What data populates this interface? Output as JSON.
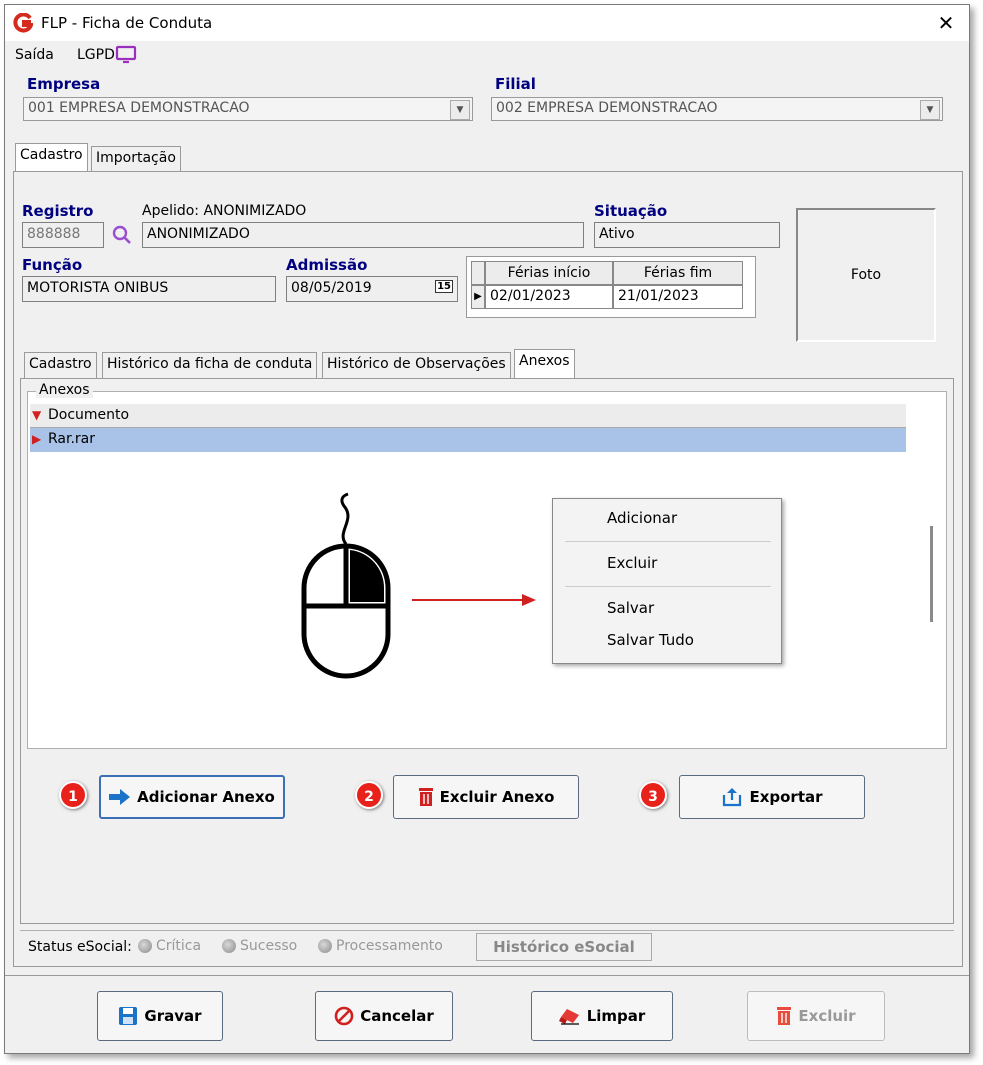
{
  "window": {
    "title": "FLP - Ficha de Conduta"
  },
  "menu": {
    "saida": "Saída",
    "lgpd": "LGPD"
  },
  "empresa": {
    "label": "Empresa",
    "value": "001 EMPRESA DEMONSTRACAO"
  },
  "filial": {
    "label": "Filial",
    "value": "002 EMPRESA DEMONSTRACAO"
  },
  "top_tabs": [
    "Cadastro",
    "Importação"
  ],
  "employee": {
    "registro_label": "Registro",
    "registro_value": "888888",
    "apelido_label": "Apelido: ANONIMIZADO",
    "nome_value": "ANONIMIZADO",
    "situacao_label": "Situação",
    "situacao_value": "Ativo",
    "funcao_label": "Função",
    "funcao_value": "MOTORISTA ONIBUS",
    "admissao_label": "Admissão",
    "admissao_value": "08/05/2019",
    "calendar_icon_text": "15",
    "foto_label": "Foto"
  },
  "ferias": {
    "columns": [
      "Férias início",
      "Férias fim"
    ],
    "rows": [
      [
        "02/01/2023",
        "21/01/2023"
      ]
    ]
  },
  "inner_tabs": [
    "Cadastro",
    "Histórico da ficha de conduta",
    "Histórico de Observações",
    "Anexos"
  ],
  "anexos": {
    "group_label": "Anexos",
    "column": "Documento",
    "rows": [
      "Rar.rar"
    ]
  },
  "context_menu": [
    "Adicionar",
    "Excluir",
    "Salvar",
    "Salvar Tudo"
  ],
  "actions": {
    "badges": [
      "1",
      "2",
      "3"
    ],
    "add": "Adicionar Anexo",
    "delete": "Excluir Anexo",
    "export": "Exportar"
  },
  "esocial": {
    "label": "Status eSocial:",
    "options": [
      "Crítica",
      "Sucesso",
      "Processamento"
    ],
    "history_button": "Histórico eSocial"
  },
  "footer": {
    "gravar": "Gravar",
    "cancelar": "Cancelar",
    "limpar": "Limpar",
    "excluir": "Excluir"
  },
  "colors": {
    "label_blue": "#000080",
    "selection": "#a9c3e8",
    "badge_red": "#e8211b",
    "icon_blue": "#1a73c8"
  }
}
